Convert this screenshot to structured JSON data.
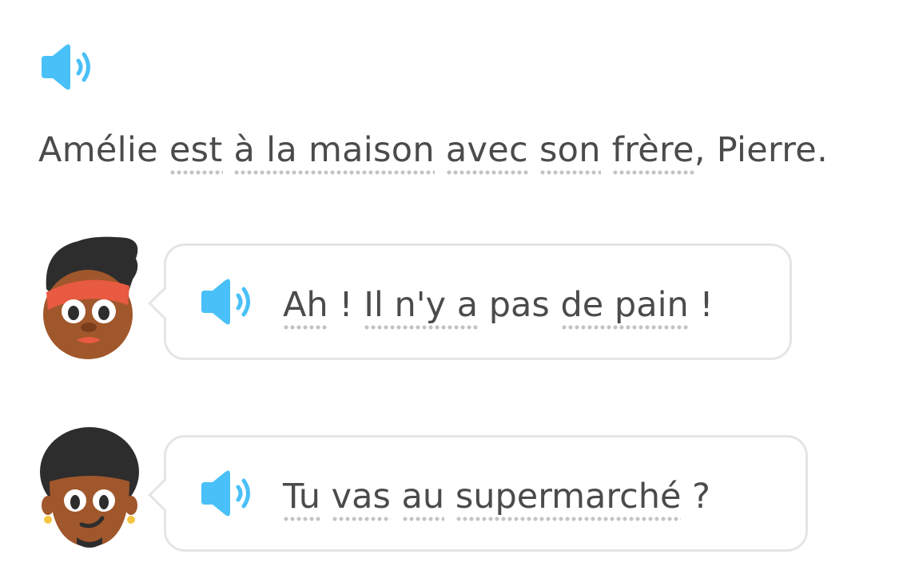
{
  "narration": {
    "words": [
      {
        "text": "Amélie ",
        "hint": false
      },
      {
        "text": "est",
        "hint": true
      },
      {
        "text": " ",
        "hint": false
      },
      {
        "text": "à la maison",
        "hint": true
      },
      {
        "text": " ",
        "hint": false
      },
      {
        "text": "avec",
        "hint": true
      },
      {
        "text": " ",
        "hint": false
      },
      {
        "text": "son",
        "hint": true
      },
      {
        "text": " ",
        "hint": false
      },
      {
        "text": "frère",
        "hint": true
      },
      {
        "text": ", Pierre.",
        "hint": false
      }
    ]
  },
  "dialogue": [
    {
      "speaker": "woman",
      "words": [
        {
          "text": "Ah",
          "hint": true
        },
        {
          "text": " ! ",
          "hint": false
        },
        {
          "text": "Il n'y a",
          "hint": true
        },
        {
          "text": " ",
          "hint": false
        },
        {
          "text": "pas",
          "hint": false
        },
        {
          "text": " ",
          "hint": false
        },
        {
          "text": "de pain",
          "hint": true
        },
        {
          "text": " !",
          "hint": false
        }
      ]
    },
    {
      "speaker": "man",
      "words": [
        {
          "text": "Tu",
          "hint": true
        },
        {
          "text": " ",
          "hint": false
        },
        {
          "text": "vas",
          "hint": true
        },
        {
          "text": " ",
          "hint": false
        },
        {
          "text": "au",
          "hint": true
        },
        {
          "text": " ",
          "hint": false
        },
        {
          "text": "supermarché",
          "hint": true
        },
        {
          "text": " ?",
          "hint": false
        }
      ]
    }
  ],
  "colors": {
    "speaker_icon": "#49c0f8",
    "text": "#4b4b4b",
    "bubble_border": "#e5e5e5",
    "hint_dots": "#c4c4c4"
  },
  "icons": {
    "speaker": "speaker-icon",
    "avatar_1": "woman-avatar-icon",
    "avatar_2": "man-avatar-icon"
  }
}
